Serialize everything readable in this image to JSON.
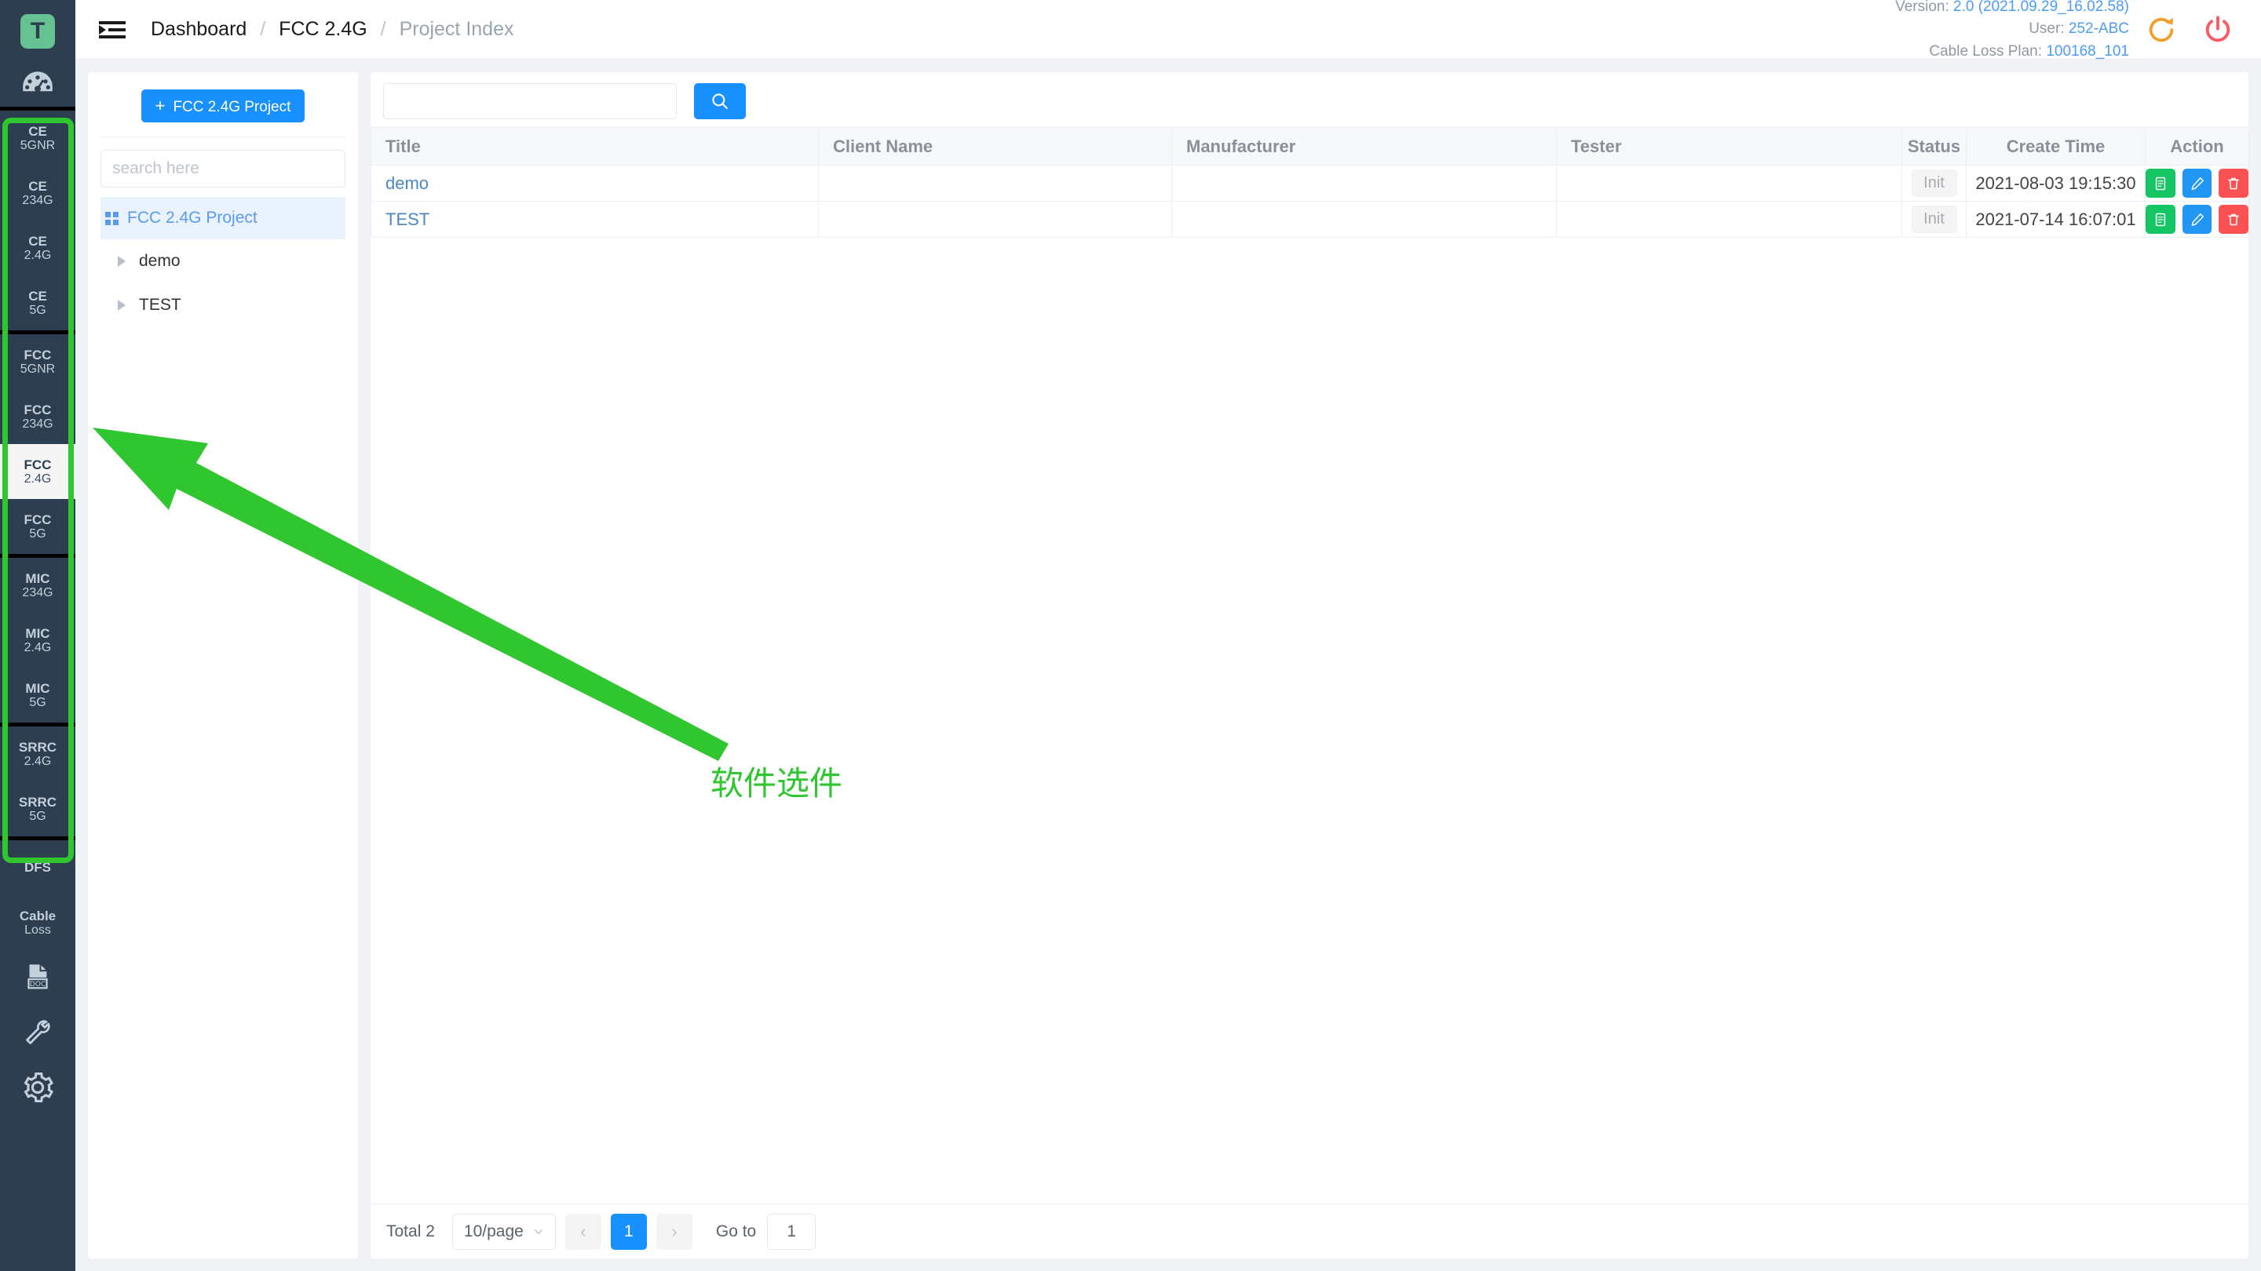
{
  "rail": {
    "logo_letter": "T",
    "dashboard_icon": "dashboard-gauge-icon",
    "groups": [
      {
        "items": [
          {
            "l1": "CE",
            "l2": "5GNR",
            "active": false
          },
          {
            "l1": "CE",
            "l2": "234G",
            "active": false
          },
          {
            "l1": "CE",
            "l2": "2.4G",
            "active": false
          },
          {
            "l1": "CE",
            "l2": "5G",
            "active": false
          }
        ]
      },
      {
        "items": [
          {
            "l1": "FCC",
            "l2": "5GNR",
            "active": false
          },
          {
            "l1": "FCC",
            "l2": "234G",
            "active": false
          },
          {
            "l1": "FCC",
            "l2": "2.4G",
            "active": true
          },
          {
            "l1": "FCC",
            "l2": "5G",
            "active": false
          }
        ]
      },
      {
        "items": [
          {
            "l1": "MIC",
            "l2": "234G",
            "active": false
          },
          {
            "l1": "MIC",
            "l2": "2.4G",
            "active": false
          },
          {
            "l1": "MIC",
            "l2": "5G",
            "active": false
          }
        ]
      },
      {
        "items": [
          {
            "l1": "SRRC",
            "l2": "2.4G",
            "active": false
          },
          {
            "l1": "SRRC",
            "l2": "5G",
            "active": false
          }
        ]
      },
      {
        "items": [
          {
            "l1": "DFS",
            "l2": "",
            "active": false
          }
        ]
      },
      {
        "items": [
          {
            "l1": "Cable",
            "l2": "Loss",
            "active": false
          }
        ]
      }
    ],
    "bottom_icons": [
      "doc-icon",
      "wrench-icon",
      "gear-icon"
    ]
  },
  "annotation": {
    "text": "软件选件",
    "color": "#2fc62f"
  },
  "header": {
    "menu_icon": "menu-fold-icon",
    "breadcrumb": [
      "Dashboard",
      "FCC 2.4G",
      "Project Index"
    ],
    "separator": "/",
    "meta": {
      "version_label": "Version:",
      "version_value": "2.0 (2021.09.29_16.02.58)",
      "user_label": "User:",
      "user_value": "252-ABC",
      "cable_loss_label": "Cable Loss Plan:",
      "cable_loss_value": "100168_101"
    },
    "refresh_icon": "refresh-icon",
    "refresh_color": "#f0a028",
    "power_icon": "power-icon",
    "power_color": "#fa5a64"
  },
  "tree": {
    "add_button_label": "FCC 2.4G Project",
    "add_button_plus": "+",
    "search_placeholder": "search here",
    "search_value": "",
    "root_label": "FCC 2.4G Project",
    "nodes": [
      "demo",
      "TEST"
    ]
  },
  "main": {
    "search_value": "",
    "search_placeholder": "",
    "search_icon": "search-icon",
    "columns": [
      "Title",
      "Client Name",
      "Manufacturer",
      "Tester",
      "Status",
      "Create Time",
      "Action"
    ],
    "rows": [
      {
        "title": "demo",
        "client_name": "",
        "manufacturer": "",
        "tester": "",
        "status": "Init",
        "create_time": "2021-08-03 19:15:30"
      },
      {
        "title": "TEST",
        "client_name": "",
        "manufacturer": "",
        "tester": "",
        "status": "Init",
        "create_time": "2021-07-14 16:07:01"
      }
    ],
    "actions": [
      {
        "name": "report-button",
        "icon": "document-icon",
        "color": "#15c563"
      },
      {
        "name": "edit-button",
        "icon": "pencil-icon",
        "color": "#2196f3"
      },
      {
        "name": "delete-button",
        "icon": "trash-icon",
        "color": "#fa5252"
      }
    ]
  },
  "pagination": {
    "total_label": "Total 2",
    "page_size": "10/page",
    "prev": "‹",
    "current_page": "1",
    "next": "›",
    "goto_label": "Go to",
    "goto_value": "1"
  }
}
